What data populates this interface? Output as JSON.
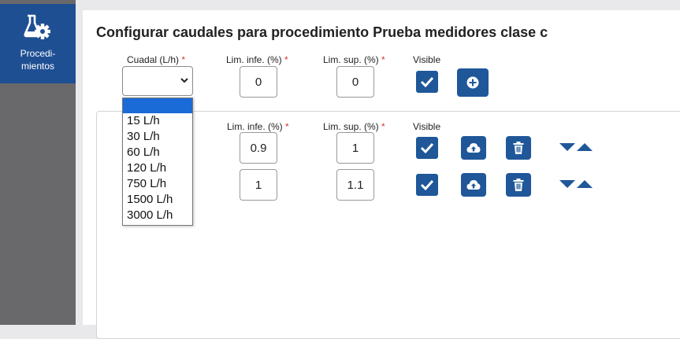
{
  "sidebar": {
    "items": [
      {
        "label": "Procedi-\nmientos",
        "icon": "flask-gear-icon",
        "active": true
      }
    ]
  },
  "page": {
    "title": "Configurar caudales para procedimiento Prueba medidores clase c"
  },
  "form": {
    "caudal_label": "Cuadal (L/h)",
    "lim_inf_label": "Lim. infe. (%)",
    "lim_sup_label": "Lim. sup. (%)",
    "visible_label": "Visible",
    "required_mark": "*",
    "caudal_value": "",
    "lim_inf_value": "0",
    "lim_sup_value": "0",
    "visible_checked": true,
    "add_icon": "plus-circle-icon"
  },
  "dropdown": {
    "options": [
      "",
      "15 L/h",
      "30 L/h",
      "60 L/h",
      "120 L/h",
      "750 L/h",
      "1500 L/h",
      "3000 L/h"
    ]
  },
  "table": {
    "lim_inf_label": "Lim. infe. (%)",
    "lim_sup_label": "Lim. sup. (%)",
    "visible_label": "Visible",
    "required_mark": "*",
    "rows": [
      {
        "lim_inf": "0.9",
        "lim_sup": "1",
        "visible": true
      },
      {
        "lim_inf": "1",
        "lim_sup": "1.1",
        "visible": true
      }
    ]
  },
  "colors": {
    "primary": "#1f5799",
    "nav_active": "#1f4f93",
    "sidebar": "#69696b",
    "required": "#d9342b",
    "option_highlight": "#1a6ad8"
  }
}
